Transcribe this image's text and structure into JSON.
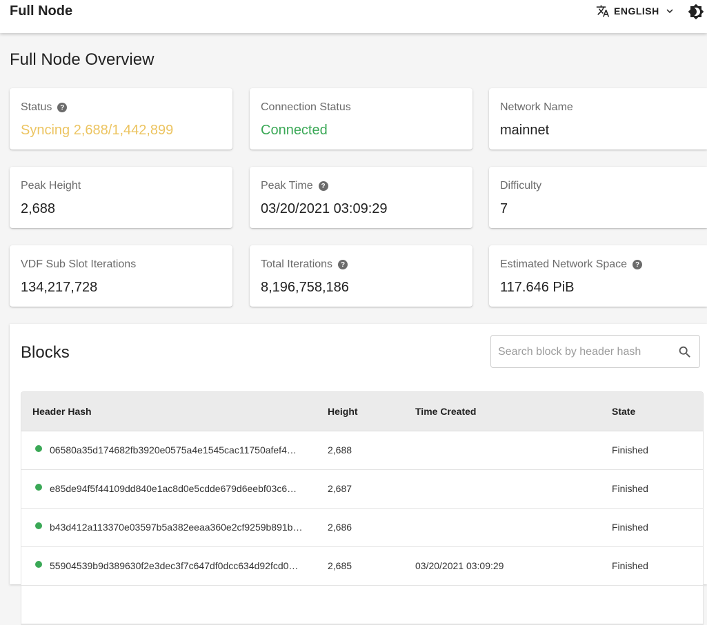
{
  "appbar": {
    "title": "Full Node",
    "language": "ENGLISH"
  },
  "page": {
    "title": "Full Node Overview"
  },
  "colors": {
    "syncing": "#ecc461",
    "connected": "#3aa856",
    "status_dot": "#3aa856"
  },
  "cards": {
    "status": {
      "label": "Status",
      "value": "Syncing 2,688/1,442,899"
    },
    "connection": {
      "label": "Connection Status",
      "value": "Connected"
    },
    "network": {
      "label": "Network Name",
      "value": "mainnet"
    },
    "peak_height": {
      "label": "Peak Height",
      "value": "2,688"
    },
    "peak_time": {
      "label": "Peak Time",
      "value": "03/20/2021 03:09:29"
    },
    "difficulty": {
      "label": "Difficulty",
      "value": "7"
    },
    "vdf": {
      "label": "VDF Sub Slot Iterations",
      "value": "134,217,728"
    },
    "total_iterations": {
      "label": "Total Iterations",
      "value": "8,196,758,186"
    },
    "net_space": {
      "label": "Estimated Network Space",
      "value": "117.646 PiB"
    }
  },
  "blocks": {
    "title": "Blocks",
    "search_placeholder": "Search block by header hash",
    "columns": [
      "Header Hash",
      "Height",
      "Time Created",
      "State"
    ],
    "rows": [
      {
        "hash": "06580a35d174682fb3920e0575a4e1545cac11750afef4…",
        "height": "2,688",
        "time": "",
        "state": "Finished"
      },
      {
        "hash": "e85de94f5f44109dd840e1ac8d0e5cdde679d6eebf03c6…",
        "height": "2,687",
        "time": "",
        "state": "Finished"
      },
      {
        "hash": "b43d412a113370e03597b5a382eeaa360e2cf9259b891b…",
        "height": "2,686",
        "time": "",
        "state": "Finished"
      },
      {
        "hash": "55904539b9d389630f2e3dec3f7c647df0dcc634d92fcd0…",
        "height": "2,685",
        "time": "03/20/2021 03:09:29",
        "state": "Finished"
      }
    ]
  }
}
